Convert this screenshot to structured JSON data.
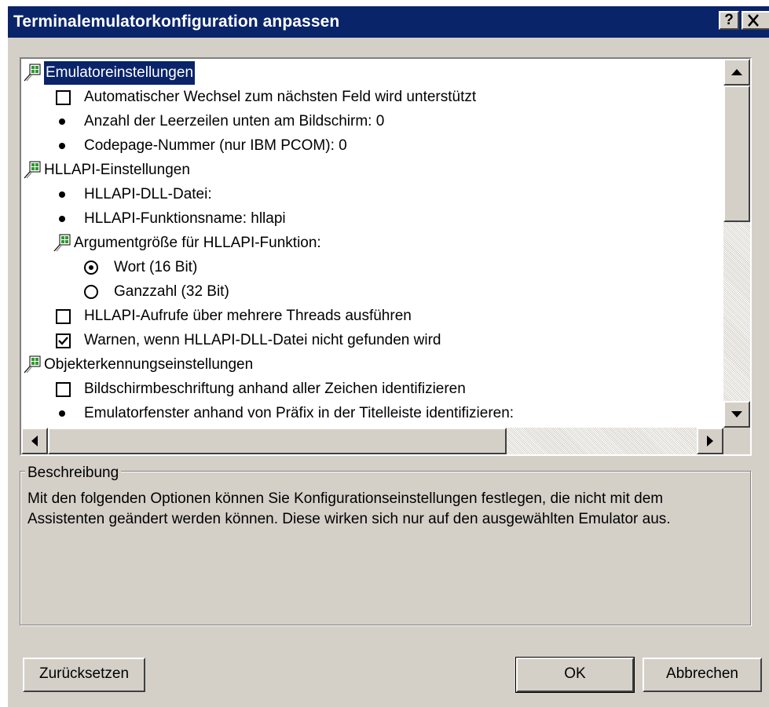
{
  "window": {
    "title": "Terminalemulatorkonfiguration anpassen",
    "help_label": "?",
    "close_label": "×"
  },
  "tree": {
    "rows": [
      {
        "type": "group",
        "label": "Emulatoreinstellungen",
        "selected": true
      },
      {
        "type": "checkbox",
        "label": "Automatischer Wechsel zum nächsten Feld wird unterstützt",
        "checked": false
      },
      {
        "type": "bullet",
        "label": "Anzahl der Leerzeilen unten am Bildschirm: 0"
      },
      {
        "type": "bullet",
        "label": "Codepage-Nummer (nur IBM PCOM): 0"
      },
      {
        "type": "group",
        "label": "HLLAPI-Einstellungen"
      },
      {
        "type": "bullet",
        "label": "HLLAPI-DLL-Datei:"
      },
      {
        "type": "bullet",
        "label": "HLLAPI-Funktionsname: hllapi"
      },
      {
        "type": "group",
        "label": "Argumentgröße für HLLAPI-Funktion:"
      },
      {
        "type": "radio",
        "label": "Wort (16 Bit)",
        "checked": true
      },
      {
        "type": "radio",
        "label": "Ganzzahl (32 Bit)",
        "checked": false
      },
      {
        "type": "checkbox",
        "label": "HLLAPI-Aufrufe über mehrere Threads ausführen",
        "checked": false
      },
      {
        "type": "checkbox",
        "label": "Warnen, wenn HLLAPI-DLL-Datei nicht gefunden wird",
        "checked": true
      },
      {
        "type": "group",
        "label": "Objekterkennungseinstellungen"
      },
      {
        "type": "checkbox",
        "label": "Bildschirmbeschriftung anhand aller Zeichen identifizieren",
        "checked": false
      },
      {
        "type": "bullet",
        "label": "Emulatorfenster anhand von Präfix in der Titelleiste identifizieren:"
      }
    ],
    "vscroll_position": 0.0,
    "hscroll_position": 0.0
  },
  "description": {
    "title": "Beschreibung",
    "text": "Mit den folgenden Optionen können Sie Konfigurationseinstellungen festlegen, die nicht mit dem Assistenten geändert werden können. Diese wirken sich nur auf den ausgewählten Emulator aus."
  },
  "buttons": {
    "reset": "Zurücksetzen",
    "ok": "OK",
    "cancel": "Abbrechen"
  },
  "colors": {
    "title_bar": "#0a246a",
    "dialog_bg": "#d4d0c8",
    "selection": "#0a246a",
    "icon_green": "#2e9a2e"
  }
}
